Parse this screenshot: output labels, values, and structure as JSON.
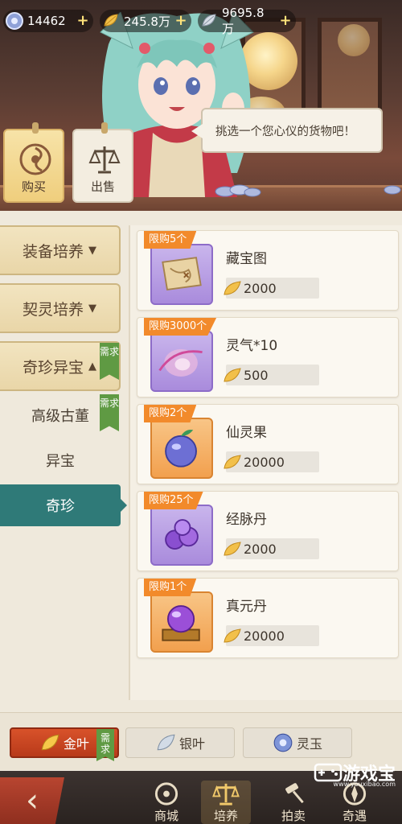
{
  "currencies": [
    {
      "name": "jade",
      "icon": "jade-orb-icon",
      "value": "14462"
    },
    {
      "name": "gold-leaf",
      "icon": "gold-leaf-icon",
      "value": "245.8万"
    },
    {
      "name": "silver-leaf",
      "icon": "silver-leaf-icon",
      "value": "9695.8万"
    }
  ],
  "npc": {
    "speech": "挑选一个您心仪的货物吧！"
  },
  "mode_tabs": {
    "buy": "购买",
    "sell": "出售"
  },
  "categories": {
    "equipment": "装备培养",
    "contract": "契灵培养",
    "treasure": "奇珍异宝",
    "need_badge": "需求",
    "sub_items": [
      "高级古董",
      "异宝",
      "奇珍"
    ],
    "selected": "奇珍"
  },
  "items": [
    {
      "limit": "限购5个",
      "name": "藏宝图",
      "price": "2000",
      "frame": "purple",
      "icon": "treasure-map-icon"
    },
    {
      "limit": "限购3000个",
      "name": "灵气*10",
      "price": "500",
      "frame": "purple",
      "icon": "spirit-essence-icon"
    },
    {
      "limit": "限购2个",
      "name": "仙灵果",
      "price": "20000",
      "frame": "orange",
      "icon": "spirit-fruit-icon"
    },
    {
      "limit": "限购25个",
      "name": "经脉丹",
      "price": "2000",
      "frame": "purple",
      "icon": "meridian-pill-icon"
    },
    {
      "limit": "限购1个",
      "name": "真元丹",
      "price": "20000",
      "frame": "orange",
      "icon": "true-essence-pill-icon"
    }
  ],
  "currency_tabs": {
    "gold": "金叶",
    "silver": "银叶",
    "jade": "灵玉",
    "need_badge": "需求",
    "selected": "金叶"
  },
  "bottom_nav": {
    "back": "‹",
    "items": [
      "商城",
      "培养",
      "拍卖",
      "奇遇"
    ],
    "selected": "培养"
  },
  "watermark": {
    "title": "游戏宝",
    "sub": "www.youxibao.com"
  },
  "colors": {
    "accent_teal": "#2f7a78",
    "limit_orange": "#f28a2b",
    "need_green": "#5f9a43",
    "gold_tab_red": "#c2431f"
  }
}
